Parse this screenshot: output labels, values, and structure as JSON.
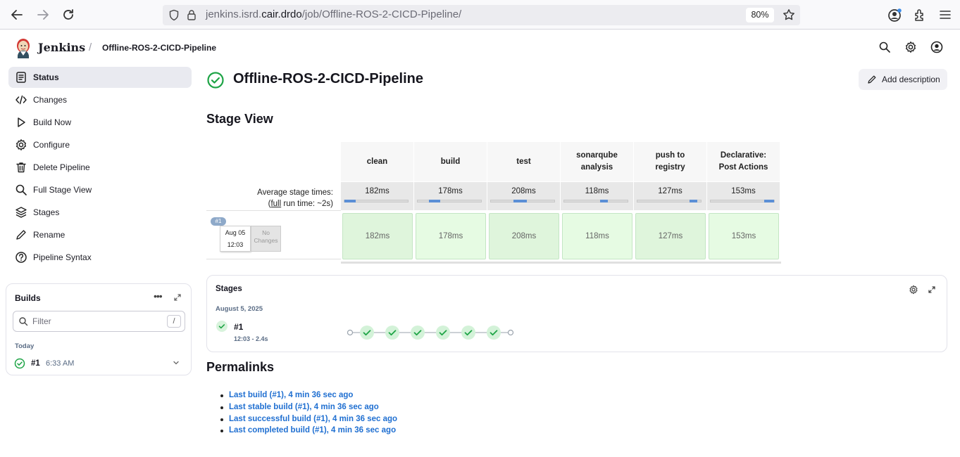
{
  "browser": {
    "url_host_prefix": "jenkins.isrd.",
    "url_host_main": "cair.drdo",
    "url_path": "/job/Offline-ROS-2-CICD-Pipeline/",
    "zoom": "80%"
  },
  "header": {
    "brand": "Jenkins",
    "breadcrumb_sep": "/",
    "breadcrumb_job": "Offline-ROS-2-CICD-Pipeline"
  },
  "sidebar": {
    "items": [
      {
        "label": "Status",
        "icon": "document-icon"
      },
      {
        "label": "Changes",
        "icon": "code-icon"
      },
      {
        "label": "Build Now",
        "icon": "play-icon"
      },
      {
        "label": "Configure",
        "icon": "gear-icon"
      },
      {
        "label": "Delete Pipeline",
        "icon": "trash-icon"
      },
      {
        "label": "Full Stage View",
        "icon": "search-icon"
      },
      {
        "label": "Stages",
        "icon": "layers-icon"
      },
      {
        "label": "Rename",
        "icon": "pencil-icon"
      },
      {
        "label": "Pipeline Syntax",
        "icon": "help-icon"
      }
    ]
  },
  "builds": {
    "title": "Builds",
    "more": "•••",
    "filter_placeholder": "Filter",
    "filter_key": "/",
    "group_label": "Today",
    "row_number": "#1",
    "row_time": "6:33 AM",
    "status_color": "#1ea446"
  },
  "main": {
    "title": "Offline-ROS-2-CICD-Pipeline",
    "add_description": "Add description",
    "stage_view_title": "Stage View",
    "avg_label_line1": "Average stage times:",
    "avg_label_pre": "(",
    "avg_label_full": "full",
    "avg_label_post": " run time: ~2s)",
    "run_badge": "#1",
    "run_date": "Aug 05",
    "run_time": "12:03",
    "run_changes_1": "No",
    "run_changes_2": "Changes",
    "stages": [
      {
        "name_1": "clean",
        "name_2": "",
        "avg": "182ms",
        "cell": "182ms",
        "progress_from": 0.0,
        "progress_to": 0.18
      },
      {
        "name_1": "build",
        "name_2": "",
        "avg": "178ms",
        "cell": "178ms",
        "progress_from": 0.18,
        "progress_to": 0.36
      },
      {
        "name_1": "test",
        "name_2": "",
        "avg": "208ms",
        "cell": "208ms",
        "progress_from": 0.36,
        "progress_to": 0.57
      },
      {
        "name_1": "sonarqube",
        "name_2": "analysis",
        "avg": "118ms",
        "cell": "118ms",
        "progress_from": 0.57,
        "progress_to": 0.69
      },
      {
        "name_1": "push to",
        "name_2": "registry",
        "avg": "127ms",
        "cell": "127ms",
        "progress_from": 0.82,
        "progress_to": 0.94
      },
      {
        "name_1": "Declarative:",
        "name_2": "Post Actions",
        "avg": "153ms",
        "cell": "153ms",
        "progress_from": 0.84,
        "progress_to": 1.0
      }
    ],
    "cell_colors": [
      "#dff5dc",
      "#e6fbe3"
    ],
    "progress_color": "#5b8fd6"
  },
  "stages_card": {
    "title": "Stages",
    "date": "August 5, 2025",
    "run": "#1",
    "meta": "12:03 - 2.4s",
    "node_count": 6
  },
  "permalinks": {
    "title": "Permalinks",
    "links": [
      "Last build (#1), 4 min 36 sec ago",
      "Last stable build (#1), 4 min 36 sec ago",
      "Last successful build (#1), 4 min 36 sec ago",
      "Last completed build (#1), 4 min 36 sec ago"
    ]
  }
}
